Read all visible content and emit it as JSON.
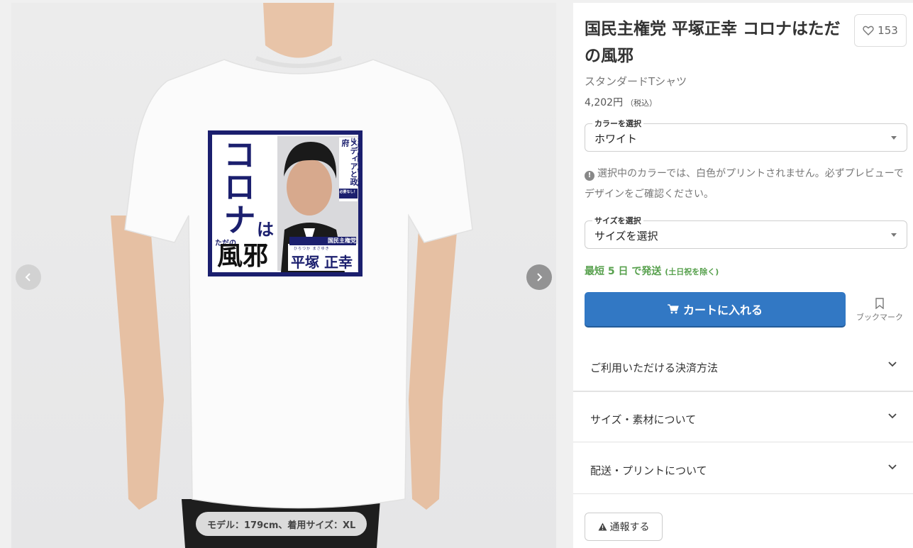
{
  "gallery": {
    "caption": "モデル：179cm、着用サイズ：XL",
    "print": {
      "big_text_top": "コロナ",
      "big_text_ha": "は",
      "small_tadano": "ただの",
      "big_text_bottom": "風邪",
      "side_text_1": "コロナ騒動を作ったのは",
      "side_text_2": "メディアと政府",
      "side_badge": "必要なし！",
      "party_name": "国民主権党",
      "candidate_name": "平塚 正幸",
      "candidate_ruby": "ひらつか まさゆき"
    }
  },
  "product": {
    "title": "国民主権党 平塚正幸 コロナはただの風邪",
    "like_count": "153",
    "subtitle": "スタンダードTシャツ",
    "price": "4,202円",
    "price_tax": "（税込）"
  },
  "color_select": {
    "legend": "カラーを選択",
    "value": "ホワイト"
  },
  "notice": "選択中のカラーでは、白色がプリントされません。必ずプレビューでデザインをご確認ください。",
  "size_select": {
    "legend": "サイズを選択",
    "value": "サイズを選択"
  },
  "shipping": {
    "main": "最短 5 日 で発送",
    "note": "(土日祝を除く)"
  },
  "cart_button": "カートに入れる",
  "bookmark_label": "ブックマーク",
  "accordions": [
    {
      "label": "ご利用いただける決済方法"
    },
    {
      "label": "サイズ・素材について"
    },
    {
      "label": "配送・プリントについて"
    }
  ],
  "report_button": "通報する",
  "colors": {
    "accent": "#3278c4",
    "ship_green": "#58a14e",
    "print_navy": "#1b1f6e"
  }
}
